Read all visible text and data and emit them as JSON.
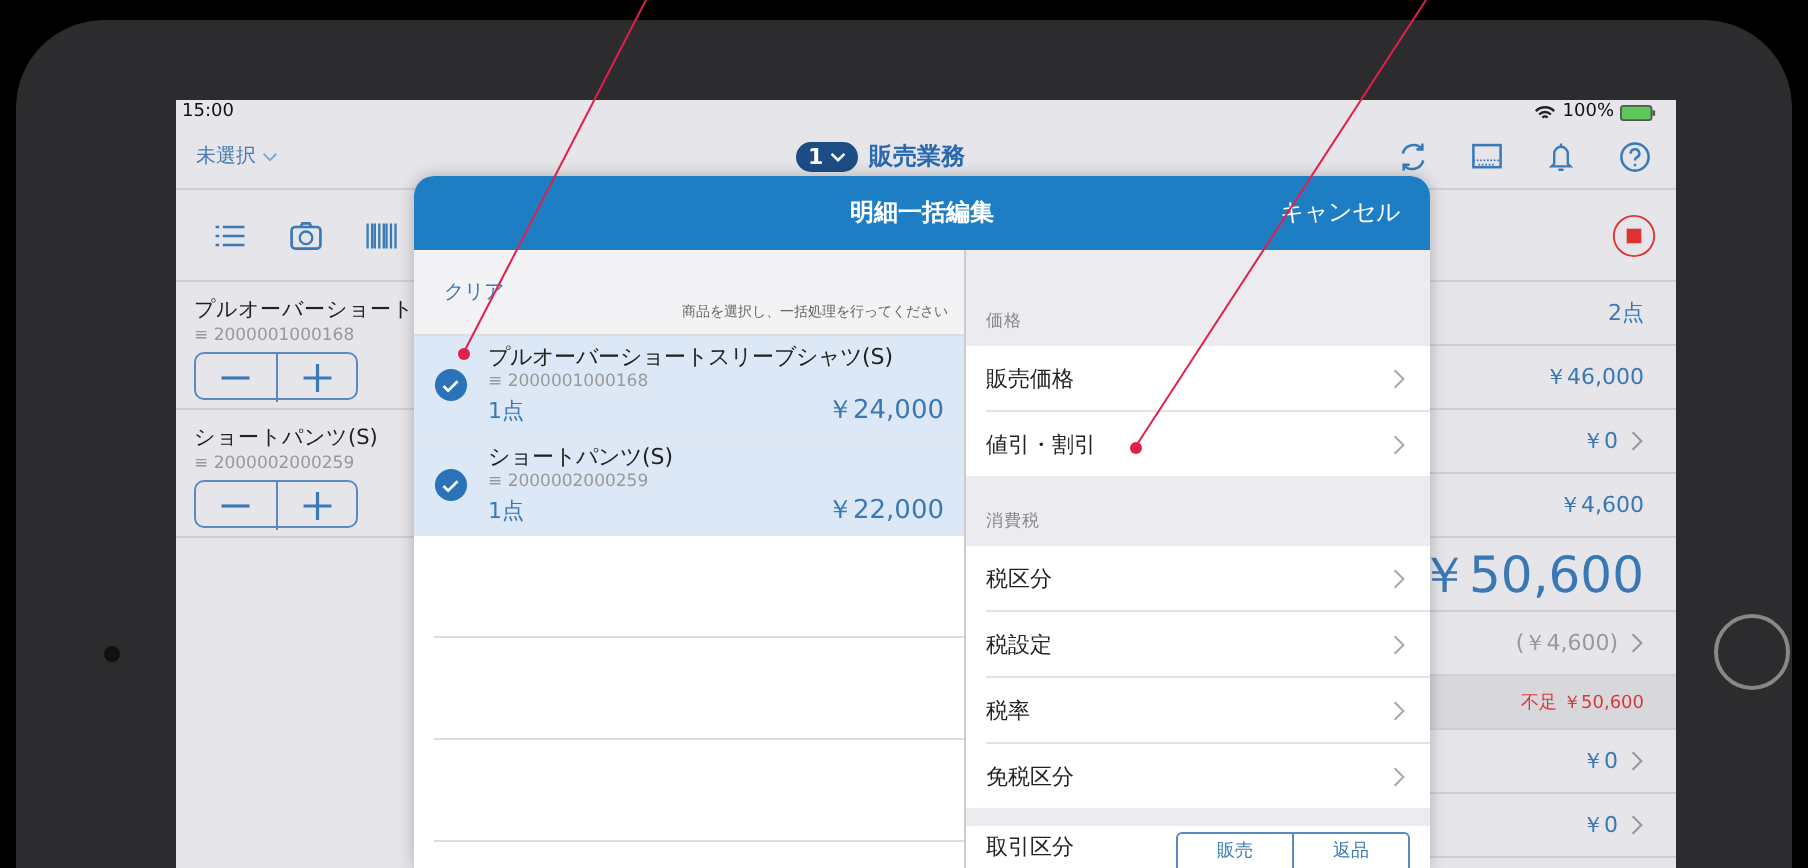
{
  "status_bar": {
    "time": "15:00",
    "battery": "100%"
  },
  "nav": {
    "store_picker": "未選択",
    "badge": "1",
    "title": "販売業務"
  },
  "cart_items": [
    {
      "name": "プルオーバーショート",
      "code": "≡ 2000001000168"
    },
    {
      "name": "ショートパンツ(S)",
      "code": "≡ 2000002000259"
    }
  ],
  "summary_rows": [
    {
      "kind": "value",
      "value": "2点",
      "chevron": false
    },
    {
      "kind": "value",
      "value": "￥46,000",
      "chevron": false
    },
    {
      "kind": "value",
      "value": "￥0",
      "chevron": true
    },
    {
      "kind": "value",
      "value": "￥4,600",
      "chevron": false
    },
    {
      "kind": "total",
      "value": "￥50,600",
      "chevron": false
    },
    {
      "kind": "muted",
      "value": "(￥4,600)",
      "chevron": true
    },
    {
      "kind": "alert",
      "value": "不足 ￥50,600",
      "chevron": false
    },
    {
      "kind": "value",
      "value": "￥0",
      "chevron": true
    },
    {
      "kind": "value",
      "value": "￥0",
      "chevron": true
    }
  ],
  "modal": {
    "title": "明細一括編集",
    "cancel": "キャンセル",
    "clear": "クリア",
    "hint": "商品を選択し、一括処理を行ってください",
    "items": [
      {
        "name": "プルオーバーショートスリーブシャツ(S)",
        "code": "≡ 2000001000168",
        "quantity": "1点",
        "price": "￥24,000",
        "selected": true
      },
      {
        "name": "ショートパンツ(S)",
        "code": "≡ 2000002000259",
        "quantity": "1点",
        "price": "￥22,000",
        "selected": true
      }
    ],
    "sections": [
      {
        "header": "価格",
        "rows": [
          "販売価格",
          "値引・割引"
        ]
      },
      {
        "header": "消費税",
        "rows": [
          "税区分",
          "税設定",
          "税率",
          "免税区分"
        ]
      }
    ],
    "transaction": {
      "label": "取引区分",
      "options": [
        "販売",
        "返品"
      ]
    }
  }
}
